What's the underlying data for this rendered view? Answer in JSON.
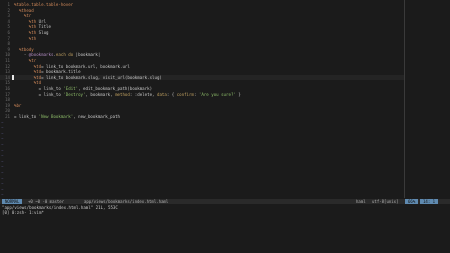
{
  "editor": {
    "lines": [
      {
        "n": "1",
        "code": "%table.table.table-hover"
      },
      {
        "n": "2",
        "code": "  %thead"
      },
      {
        "n": "3",
        "code": "    %tr"
      },
      {
        "n": "4",
        "code": "      %th Url"
      },
      {
        "n": "5",
        "code": "      %th Title"
      },
      {
        "n": "6",
        "code": "      %th Slug"
      },
      {
        "n": "7",
        "code": "      %th"
      },
      {
        "n": "8",
        "code": ""
      },
      {
        "n": "9",
        "code": "  %tbody"
      },
      {
        "n": "10",
        "code": "    - @bookmarks.each do |bookmark|"
      },
      {
        "n": "11",
        "code": "      %tr"
      },
      {
        "n": "12",
        "code": "        %td= link_to bookmark.url, bookmark.url"
      },
      {
        "n": "13",
        "code": "        %td= bookmark.title"
      },
      {
        "n": "14",
        "code": "        %td= link_to bookmark.slug, visit_url(bookmark.slug)"
      },
      {
        "n": "15",
        "code": "        %td"
      },
      {
        "n": "16",
        "code": "          = link_to 'Edit', edit_bookmark_path(bookmark)"
      },
      {
        "n": "17",
        "code": "          = link_to 'Destroy', bookmark, method: :delete, data: { confirm: 'Are you sure?' }"
      },
      {
        "n": "18",
        "code": ""
      },
      {
        "n": "19",
        "code": "%br"
      },
      {
        "n": "20",
        "code": ""
      },
      {
        "n": "21",
        "code": "= link_to 'New Bookmark', new_bookmark_path"
      }
    ],
    "current_line": 14,
    "tilde_rows": 15,
    "tilde": "~"
  },
  "statusline": {
    "mode": "NORMAL",
    "branch": "+0 ~0 -0 master",
    "file": "app/views/bookmarks/index.html.haml",
    "filetype": "haml",
    "encoding": "utf-8[unix]",
    "percent": "66%",
    "position": "14:  1"
  },
  "message": "\"app/views/bookmarks/index.html.haml\" 21L, 553C",
  "tmux": "[0] 0:zsh- 1:vim*"
}
